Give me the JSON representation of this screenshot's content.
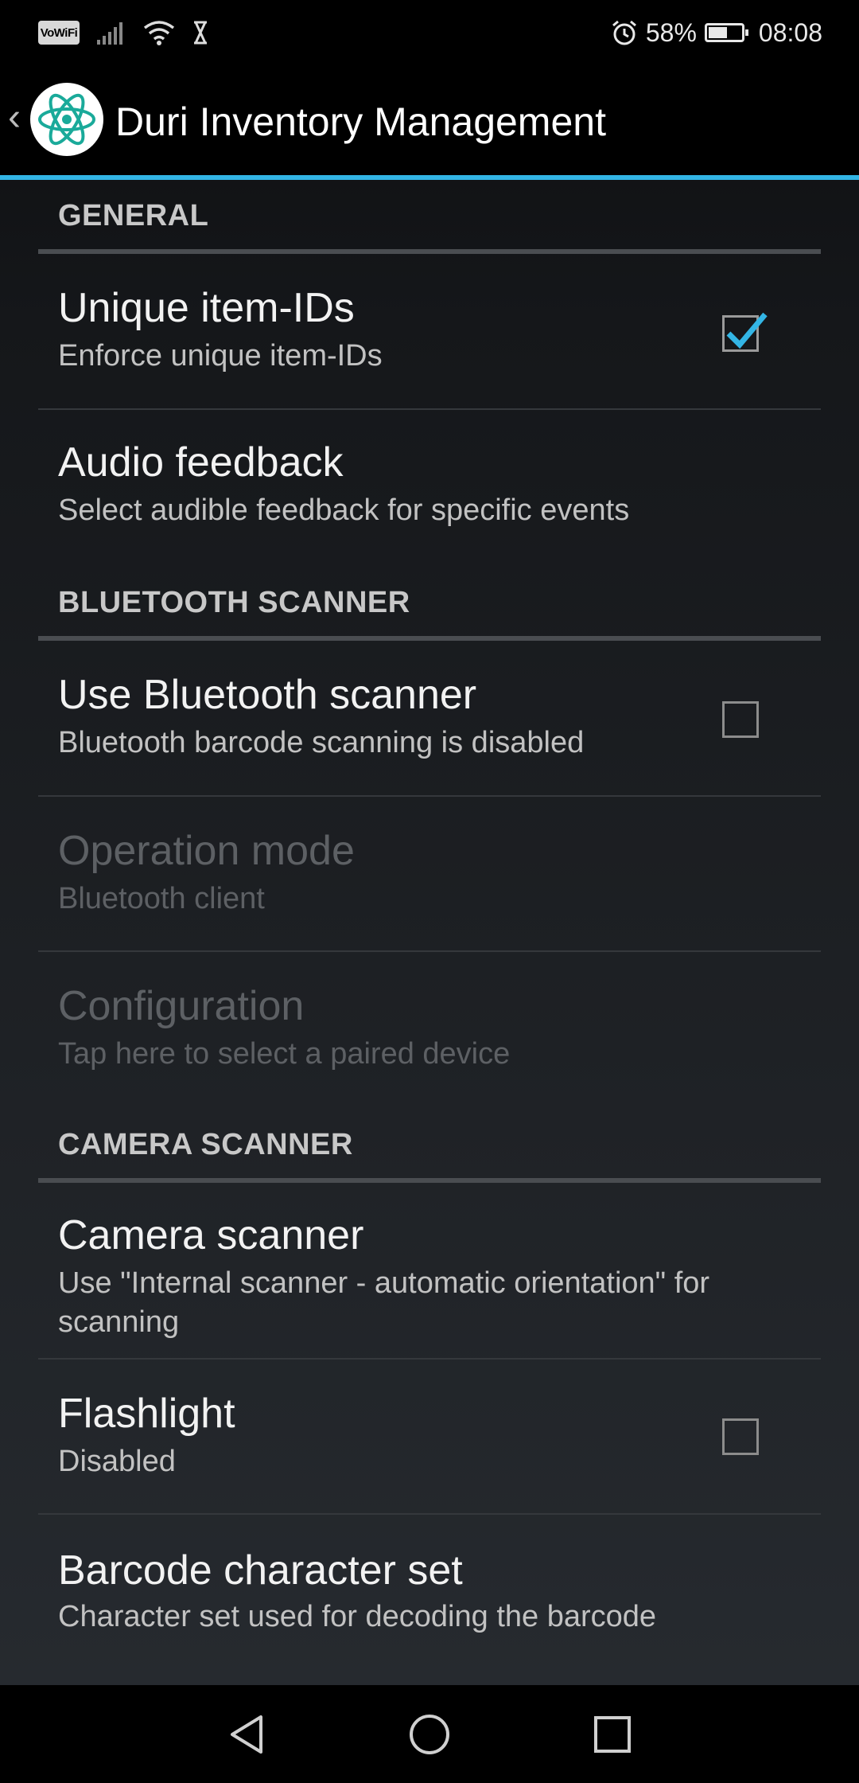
{
  "status_bar": {
    "vowifi": "VoWiFi",
    "battery_percent": "58%",
    "battery_level": 0.58,
    "time": "08:08"
  },
  "action_bar": {
    "title": "Duri Inventory Management",
    "accent_color": "#33b5e5"
  },
  "sections": {
    "general": "GENERAL",
    "bluetooth": "BLUETOOTH SCANNER",
    "camera": "CAMERA SCANNER"
  },
  "prefs": {
    "unique_ids": {
      "title": "Unique item-IDs",
      "summary": "Enforce unique item-IDs",
      "checked": true
    },
    "audio": {
      "title": "Audio feedback",
      "summary": "Select audible feedback for specific events"
    },
    "use_bt": {
      "title": "Use Bluetooth scanner",
      "summary": "Bluetooth barcode scanning is disabled",
      "checked": false
    },
    "op_mode": {
      "title": "Operation mode",
      "summary": "Bluetooth client",
      "enabled": false
    },
    "config": {
      "title": "Configuration",
      "summary": "Tap here to select a paired device",
      "enabled": false
    },
    "camera": {
      "title": "Camera scanner",
      "summary": "Use \"Internal scanner - automatic orientation\" for scanning"
    },
    "flashlight": {
      "title": "Flashlight",
      "summary": "Disabled",
      "checked": false
    },
    "charset": {
      "title": "Barcode character set",
      "summary": "Character set used for decoding the barcode"
    }
  },
  "icons": {
    "app": "atom-logo-icon",
    "nav_back": "triangle-back-icon",
    "nav_home": "circle-home-icon",
    "nav_recents": "square-recents-icon"
  }
}
